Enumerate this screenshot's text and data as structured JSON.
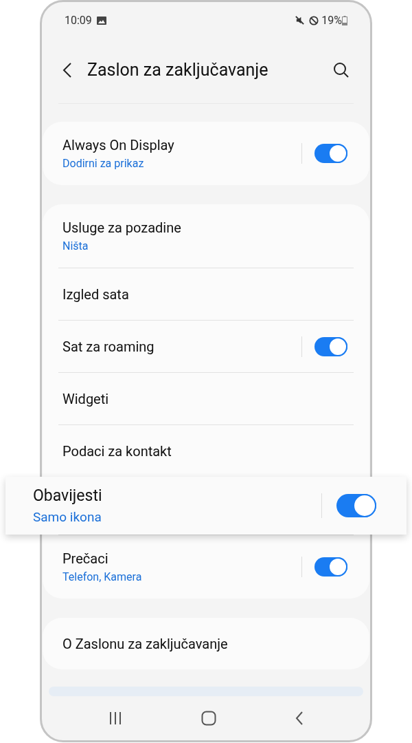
{
  "status_bar": {
    "time": "10:09",
    "battery": "19%"
  },
  "header": {
    "title": "Zaslon za zaključavanje"
  },
  "groups": [
    {
      "items": [
        {
          "title": "Always On Display",
          "subtitle": "Dodirni za prikaz",
          "kind": "toggle",
          "on": true,
          "highlighted": false
        }
      ]
    },
    {
      "items": [
        {
          "title": "Usluge za pozadine",
          "subtitle": "Ništa",
          "kind": "link",
          "highlighted": false
        },
        {
          "title": "Izgled sata",
          "kind": "link",
          "highlighted": false
        },
        {
          "title": "Sat za roaming",
          "kind": "toggle",
          "on": true,
          "highlighted": false
        },
        {
          "title": "Widgeti",
          "kind": "link",
          "highlighted": false
        },
        {
          "title": "Podaci za kontakt",
          "kind": "link",
          "highlighted": false
        },
        {
          "title": "Obavijesti",
          "subtitle": "Samo ikona",
          "kind": "toggle",
          "on": true,
          "highlighted": true
        },
        {
          "title": "Prečaci",
          "subtitle": "Telefon, Kamera",
          "kind": "toggle",
          "on": true,
          "highlighted": false
        }
      ]
    },
    {
      "items": [
        {
          "title": "O Zaslonu za zaključavanje",
          "kind": "link",
          "highlighted": false
        }
      ]
    }
  ]
}
